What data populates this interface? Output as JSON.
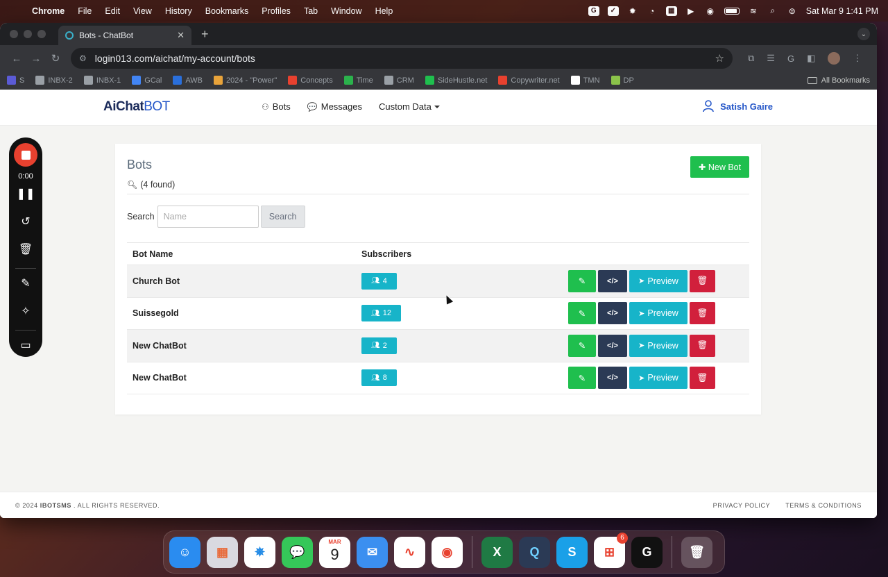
{
  "menubar": {
    "app": "Chrome",
    "items": [
      "File",
      "Edit",
      "View",
      "History",
      "Bookmarks",
      "Profiles",
      "Tab",
      "Window",
      "Help"
    ],
    "clock": "Sat Mar 9  1:41 PM"
  },
  "browser": {
    "tab_title": "Bots - ChatBot",
    "url": "login013.com/aichat/my-account/bots",
    "bookmarks": [
      {
        "label": "S",
        "color": "#5b5bd6"
      },
      {
        "label": "INBX-2",
        "color": "#9aa0a6"
      },
      {
        "label": "INBX-1",
        "color": "#9aa0a6"
      },
      {
        "label": "GCal",
        "color": "#4285f4"
      },
      {
        "label": "AWB",
        "color": "#2a6fdb"
      },
      {
        "label": "2024 - \"Power\"",
        "color": "#e8a33a"
      },
      {
        "label": "Concepts",
        "color": "#e8412f"
      },
      {
        "label": "Time",
        "color": "#2bb24c"
      },
      {
        "label": "CRM",
        "color": "#9aa0a6"
      },
      {
        "label": "SideHustle.net",
        "color": "#1fbf4e"
      },
      {
        "label": "Copywriter.net",
        "color": "#e8412f"
      },
      {
        "label": "TMN",
        "color": "#ffffff"
      },
      {
        "label": "DP",
        "color": "#8bc34a"
      }
    ],
    "all_bookmarks": "All Bookmarks"
  },
  "site": {
    "logo_bold": "AiChat",
    "logo_light": "BOT",
    "nav": {
      "bots": "Bots",
      "messages": "Messages",
      "custom_data": "Custom Data"
    },
    "user_name": "Satish Gaire"
  },
  "bots_page": {
    "title": "Bots",
    "found_text": "(4 found)",
    "new_bot_label": "New Bot",
    "search_label": "Search",
    "search_placeholder": "Name",
    "search_button": "Search",
    "columns": [
      "Bot Name",
      "Subscribers"
    ],
    "preview_label": "Preview",
    "rows": [
      {
        "name": "Church Bot",
        "subscribers": "4"
      },
      {
        "name": "Suissegold",
        "subscribers": "12"
      },
      {
        "name": "New ChatBot",
        "subscribers": "2"
      },
      {
        "name": "New ChatBot",
        "subscribers": "8"
      }
    ]
  },
  "footer": {
    "copyright": "© 2024",
    "brand": "IBOTSMS",
    "rights": ". ALL RIGHTS RESERVED.",
    "privacy": "PRIVACY POLICY",
    "terms": "TERMS & CONDITIONS"
  },
  "recorder": {
    "time": "0:00"
  },
  "dock": {
    "calendar_month": "MAR",
    "calendar_day": "9",
    "app_store_badge": "6"
  },
  "colors": {
    "green": "#1fbf4e",
    "teal": "#17b4c9",
    "navy": "#2b3a55",
    "red": "#d1203c",
    "link_blue": "#2456c8"
  }
}
